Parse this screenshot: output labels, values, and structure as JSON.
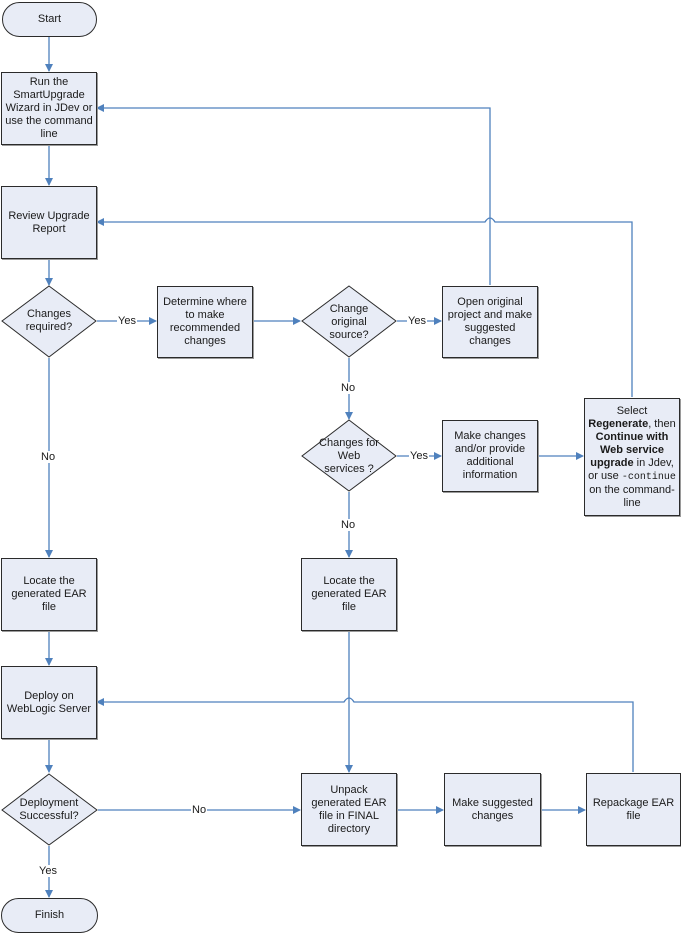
{
  "diagram": {
    "colors": {
      "connector": "#4f81bd",
      "node_fill": "#e8ecf6",
      "node_border": "#2b2b2b"
    },
    "terminals": {
      "start": "Start",
      "finish": "Finish"
    },
    "processes": {
      "run_wizard": "Run the SmartUpgrade Wizard in JDev or use the command line",
      "review_report": "Review Upgrade Report",
      "determine_where": "Determine where to make recommended changes",
      "open_original": "Open original project and make suggested changes",
      "make_changes_provide": "Make changes and/or provide additional information",
      "locate_ear_left": "Locate the generated EAR file",
      "locate_ear_mid": "Locate the generated EAR file",
      "deploy": "Deploy on WebLogic Server",
      "unpack": "Unpack generated EAR file in FINAL directory",
      "make_suggested": "Make suggested changes",
      "repackage": "Repackage EAR file"
    },
    "select_regenerate": {
      "t1": "Select",
      "t2_bold": "Regenerate",
      "t3": ", then",
      "t4_bold": "Continue with Web service upgrade",
      "t5": " in Jdev, or use",
      "t6_mono": "-continue",
      "t7": " on the command-line"
    },
    "decisions": {
      "changes_required": "Changes required?",
      "change_original": "Change original source?",
      "changes_web": "Changes for Web services ?",
      "deployment_successful": "Deployment Successful?"
    },
    "edge_labels": {
      "changes_required_yes": "Yes",
      "changes_required_no": "No",
      "change_original_yes": "Yes",
      "change_original_no": "No",
      "changes_web_yes": "Yes",
      "changes_web_no": "No",
      "deployment_no": "No",
      "deployment_yes": "Yes"
    }
  }
}
